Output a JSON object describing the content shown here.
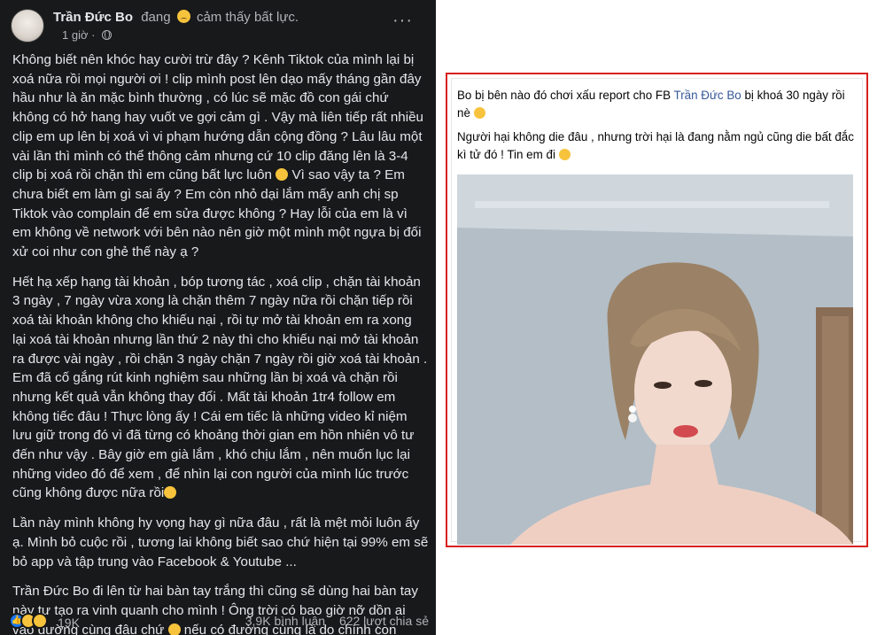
{
  "left_post": {
    "author": "Trần Đức Bo",
    "feeling_prefix": "đang",
    "feeling_text": "cảm thấy bất lực.",
    "timestamp": "1 giờ ·",
    "more_label": "···",
    "paragraphs": [
      "Không biết nên khóc hay cười trừ đây ? Kênh Tiktok của mình lại bị xoá nữa rồi mọi người ơi ! clip mình post lên dạo mấy tháng gần đây hầu như là ăn mặc bình thường , có lúc sẽ mặc đồ con gái chứ không có hở hang hay vuốt ve gợi cảm gì . Vậy mà liên tiếp rất nhiều clip em up lên bị xoá vì vi phạm hướng dẫn cộng đồng ? Lâu lâu một vài lần thì mình có thể thông cảm nhưng cứ 10 clip đăng lên là 3-4 clip bị xoá rồi chặn thì em cũng bất lực luôn",
      "Hết hạ xếp hạng tài khoản , bóp tương tác , xoá clip , chặn tài khoản 3 ngày , 7 ngày vừa xong là chặn thêm 7 ngày nữa rồi chặn tiếp rồi xoá tài khoản không cho khiếu nại , rồi tự mở tài khoản em ra xong lại xoá tài khoản nhưng lần thứ 2 này thì cho khiếu nại mở tài khoản ra được vài ngày , rồi chặn 3 ngày chặn 7 ngày rồi giờ xoá tài khoản . Em đã cố gắng rút kinh nghiệm sau những lần bị xoá và chặn rồi nhưng kết quả vẫn không thay đổi . Mất tài khoản 1tr4 follow em không tiếc đâu ! Thực lòng ấy ! Cái em tiếc là những video kỉ niệm lưu giữ trong đó vì đã từng có khoảng thời gian em hồn nhiên vô tư đến như vậy . Bây giờ em già lắm , khó chịu lắm , nên muốn lục lại những video đó để xem , để nhìn lại con người của mình lúc trước cũng không được nữa rồi",
      "Lần này mình không hy vọng hay gì nữa đâu , rất là mệt mỏi luôn ấy ạ. Mình bỏ cuộc rồi , tương lai không biết sao chứ hiện tại 99% em sẽ bỏ app và tập trung vào Facebook & Youtube ...",
      "Trần Đức Bo đi lên từ hai bàn tay trắng thì cũng sẽ dùng hai bàn tay này tự tạo ra vinh quanh cho mình ! Ông trời có bao giờ nỡ dồn ai vào đường cùng đâu chứ",
      "nếu có đường cùng là do chính con người tự dồn vào để h.ại nhau thôi ."
    ],
    "p1_tail": "Vì sao vậy ta ? Em chưa biết em làm gì sai ấy ? Em còn nhỏ dại lắm mấy anh chị sp Tiktok vào complain để em sửa được không ? Hay lỗi của em là vì em không về network với bên nào nên giờ một mình một ngựa bị đối xử coi như con ghẻ thế này ạ ?",
    "reaction_count": "19K",
    "comments": "3,9K bình luận",
    "shares": "622 lượt chia sẻ"
  },
  "right_post": {
    "line1_before": "Bo bị bên nào đó chơi xấu report cho FB",
    "line1_link": "Trần Đức Bo",
    "line1_after": "bị khoá 30 ngày rồi nè",
    "line2": "Người hại không die đâu , nhưng trời hại là đang nằm ngủ cũng die bất đắc kì tử đó ! Tin em đi",
    "frame_color": "#d8201f",
    "link_color": "#385898"
  },
  "colors": {
    "dark_bg": "#18191a",
    "dark_text": "#e4e6eb",
    "muted_text": "#b0b3b8",
    "like_blue": "#1877f2",
    "emoji_yellow": "#f7c33c"
  }
}
